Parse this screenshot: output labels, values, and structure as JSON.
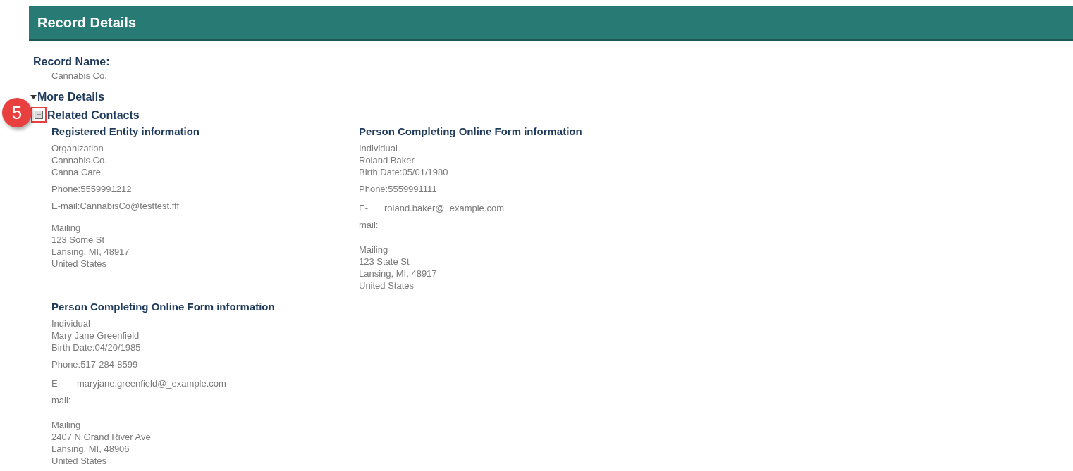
{
  "header": {
    "title": "Record Details"
  },
  "record_name": {
    "label": "Record Name:",
    "value": "Cannabis Co."
  },
  "more_details": {
    "label": "More Details",
    "expanded": true
  },
  "related_contacts": {
    "label": "Related Contacts",
    "expanded": true,
    "callout": "5",
    "contacts": [
      {
        "kind": "organization",
        "title": "Registered Entity information",
        "lines": [
          "Organization",
          "Cannabis Co.",
          "Canna Care"
        ],
        "phone": "Phone:5559991212",
        "email_label": "E-mail:",
        "email": "CannabisCo@testtest.fff",
        "address": [
          "Mailing",
          "123 Some St",
          "Lansing, MI, 48917",
          "United States"
        ]
      },
      {
        "kind": "individual",
        "title": "Person Completing Online Form information",
        "lines": [
          "Individual",
          "Roland Baker",
          "Birth Date:05/01/1980"
        ],
        "phone": "Phone:5559991111",
        "email_label": "E-mail:",
        "email": "roland.baker@_example.com",
        "address": [
          "Mailing",
          "123 State St",
          "Lansing, MI, 48917",
          "United States"
        ]
      },
      {
        "kind": "individual",
        "title": "Person Completing Online Form information",
        "lines": [
          "Individual",
          "Mary Jane Greenfield",
          "Birth Date:04/20/1985"
        ],
        "phone": "Phone:517-284-8599",
        "email_label": "E-mail:",
        "email": "maryjane.greenfield@_example.com",
        "address": [
          "Mailing",
          "2407 N Grand River Ave",
          "Lansing, MI, 48906",
          "United States"
        ]
      }
    ]
  }
}
